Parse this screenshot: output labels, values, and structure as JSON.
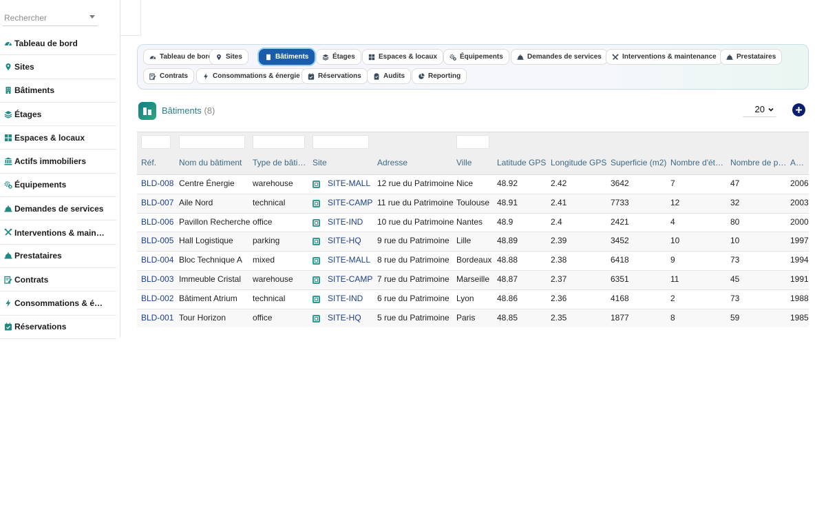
{
  "sidebar": {
    "search_placeholder": "Rechercher",
    "items": [
      {
        "label": "Tableau de bord",
        "icon": "dashboard-icon"
      },
      {
        "label": "Sites",
        "icon": "map-pin-icon"
      },
      {
        "label": "Bâtiments",
        "icon": "building-icon"
      },
      {
        "label": "Étages",
        "icon": "layers-icon"
      },
      {
        "label": "Espaces & locaux",
        "icon": "grid-icon"
      },
      {
        "label": "Actifs immobiliers",
        "icon": "landmark-icon"
      },
      {
        "label": "Équipements",
        "icon": "gears-icon"
      },
      {
        "label": "Demandes de services",
        "icon": "bell-icon"
      },
      {
        "label": "Interventions & mainꢀ…",
        "icon": "tools-icon"
      },
      {
        "label": "Prestataires",
        "icon": "bell-icon"
      },
      {
        "label": "Contrats",
        "icon": "contract-icon"
      },
      {
        "label": "Consommations & é…",
        "icon": "bolt-icon"
      },
      {
        "label": "Réservations",
        "icon": "calendar-check-icon"
      }
    ]
  },
  "tabs": [
    {
      "label": "Tableau de bord",
      "icon": "dashboard-icon",
      "active": false
    },
    {
      "label": "Sites",
      "icon": "map-pin-icon",
      "active": false
    },
    {
      "label": "Bâtiments",
      "icon": "building-icon",
      "active": true
    },
    {
      "label": "Étages",
      "icon": "layers-icon",
      "active": false
    },
    {
      "label": "Espaces & locaux",
      "icon": "grid-icon",
      "active": false
    },
    {
      "label": "Équipements",
      "icon": "gears-icon",
      "active": false
    },
    {
      "label": "Demandes de services",
      "icon": "bell-icon",
      "active": false
    },
    {
      "label": "Interventions & maintenance",
      "icon": "tools-icon",
      "active": false
    },
    {
      "label": "Prestataires",
      "icon": "bell-icon",
      "active": false
    },
    {
      "label": "Contrats",
      "icon": "contract-icon",
      "active": false
    },
    {
      "label": "Consommations & énergie",
      "icon": "bolt-icon",
      "active": false
    },
    {
      "label": "Réservations",
      "icon": "calendar-check-icon",
      "active": false
    },
    {
      "label": "Audits",
      "icon": "clipboard-icon",
      "active": false
    },
    {
      "label": "Reporting",
      "icon": "pie-chart-icon",
      "active": false
    }
  ],
  "header": {
    "title": "Bâtiments",
    "count": "(8)",
    "per_page": "20"
  },
  "table": {
    "columns": [
      "Réf.",
      "Nom du bâtiment",
      "Type de bâti…",
      "Site",
      "Adresse",
      "Ville",
      "Latitude GPS",
      "Longitude GPS",
      "Superficie (m2)",
      "Nombre d'ét…",
      "Nombre de p…",
      "Anné"
    ],
    "rows": [
      [
        "BLD-008",
        "Centre Énergie",
        "warehouse",
        "SITE-MALL",
        "12 rue du Patrimoine",
        "Nice",
        "48.92",
        "2.42",
        "3642",
        "7",
        "47",
        "2006"
      ],
      [
        "BLD-007",
        "Aile Nord",
        "technical",
        "SITE-CAMP",
        "11 rue du Patrimoine",
        "Toulouse",
        "48.91",
        "2.41",
        "7733",
        "12",
        "32",
        "2003"
      ],
      [
        "BLD-006",
        "Pavillon Recherche",
        "office",
        "SITE-IND",
        "10 rue du Patrimoine",
        "Nantes",
        "48.9",
        "2.4",
        "2421",
        "4",
        "80",
        "2000"
      ],
      [
        "BLD-005",
        "Hall Logistique",
        "parking",
        "SITE-HQ",
        "9 rue du Patrimoine",
        "Lille",
        "48.89",
        "2.39",
        "3452",
        "10",
        "10",
        "1997"
      ],
      [
        "BLD-004",
        "Bloc Technique A",
        "mixed",
        "SITE-MALL",
        "8 rue du Patrimoine",
        "Bordeaux",
        "48.88",
        "2.38",
        "6418",
        "9",
        "73",
        "1994"
      ],
      [
        "BLD-003",
        "Immeuble Cristal",
        "warehouse",
        "SITE-CAMP",
        "7 rue du Patrimoine",
        "Marseille",
        "48.87",
        "2.37",
        "6351",
        "11",
        "45",
        "1991"
      ],
      [
        "BLD-002",
        "Bâtiment Atrium",
        "technical",
        "SITE-IND",
        "6 rue du Patrimoine",
        "Lyon",
        "48.86",
        "2.36",
        "4168",
        "2",
        "73",
        "1988"
      ],
      [
        "BLD-001",
        "Tour Horizon",
        "office",
        "SITE-HQ",
        "5 rue du Patrimoine",
        "Paris",
        "48.85",
        "2.35",
        "1877",
        "8",
        "59",
        "1985"
      ]
    ]
  },
  "colors": {
    "accent": "#1a5dab",
    "teal": "#2b9a8f",
    "link": "#1b3f8f",
    "add_button": "#0b1f6e"
  }
}
